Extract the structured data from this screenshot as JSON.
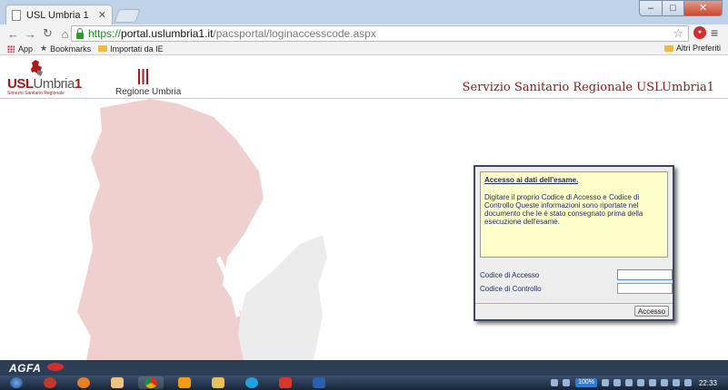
{
  "browser": {
    "tab_title": "USL Umbria 1",
    "url_scheme": "https://",
    "url_host": "portal.uslumbria1.it",
    "url_path": "/pacsportal/loginaccesscode.aspx",
    "bookmarks": [
      {
        "label": "App"
      },
      {
        "label": "Bookmarks"
      },
      {
        "label": "Importati da IE"
      }
    ],
    "other_bookmarks": "Altri Preferiti"
  },
  "header": {
    "usl_logo_bold": "USL",
    "usl_logo_light": "Umbria",
    "usl_logo_num": "1",
    "usl_logo_sub": "Servizio Sanitario Regionale",
    "regione_label": "Regione Umbria",
    "site_title": "Servizio Sanitario Regionale USLUmbria1"
  },
  "login": {
    "info_title": "Accesso ai dati dell'esame.",
    "info_body": "Digitare il proprio Codice di Accesso e Codice di Controllo Queste informazioni sono riportate nel documento che le è stato consegnato prima della esecuzione dell'esame.",
    "access_code_label": "Codice di Accesso",
    "access_code_value": "",
    "control_code_label": "Codice di Controllo",
    "control_code_value": "",
    "submit_label": "Accesso"
  },
  "footer": {
    "brand": "AGFA"
  },
  "taskbar": {
    "battery": "100%",
    "clock": "22:33"
  },
  "colors": {
    "brand_red": "#a61a1a",
    "map_pink": "#f0cfcf",
    "map_grey": "#ececec",
    "footer_bg": "#2b3e55",
    "info_bg": "#ffffcc"
  }
}
